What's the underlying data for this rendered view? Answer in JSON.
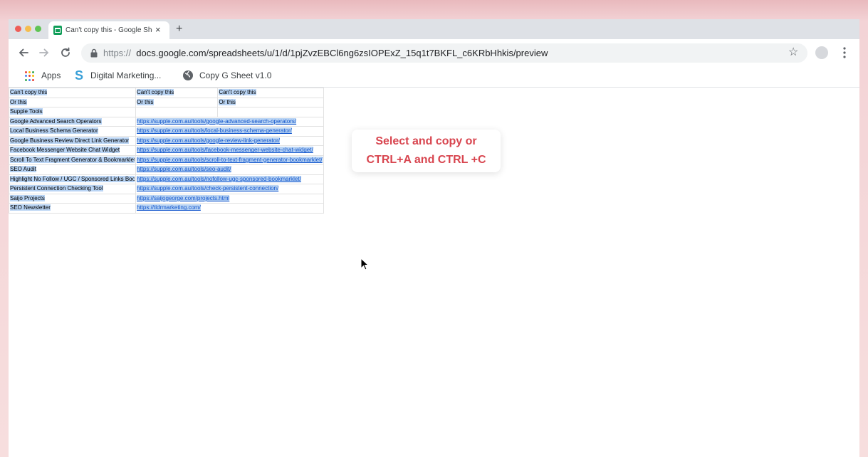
{
  "window": {
    "traffic_lights": [
      "close",
      "minimize",
      "zoom"
    ]
  },
  "tab": {
    "title": "Can't copy this - Google Sheets",
    "favicon": "google-sheets-icon",
    "close_glyph": "×",
    "new_tab_glyph": "+"
  },
  "nav": {
    "back": "back-arrow-icon",
    "forward": "forward-arrow-icon",
    "reload": "reload-icon"
  },
  "omnibox": {
    "scheme": "https://",
    "url": "docs.google.com/spreadsheets/u/1/d/1pjZvzEBCl6ng6zsIOPExZ_15q1t7BKFL_c6KRbHhkis/preview",
    "star_glyph": "☆"
  },
  "bookmarks": [
    {
      "label": "Apps",
      "icon": "apps-grid-icon"
    },
    {
      "label": "Digital Marketing...",
      "icon": "s-logo-icon"
    },
    {
      "label": "Copy G Sheet v1.0",
      "icon": "globe-icon"
    }
  ],
  "sheet": {
    "header_row": [
      "Can't copy this",
      "Can't copy this",
      "Can't copy this"
    ],
    "second_row": [
      "Or this",
      "Or this",
      "Or this"
    ],
    "section": "Supple Tools",
    "rows": [
      {
        "name": "Google Advanced Search Operators",
        "url": "https://supple.com.au/tools/google-advanced-search-operators/"
      },
      {
        "name": "Local Business Schema Generator",
        "url": "https://supple.com.au/tools/local-business-schema-generator/"
      },
      {
        "name": "Google Business Review Direct Link Generator",
        "url": "https://supple.com.au/tools/google-review-link-generator/"
      },
      {
        "name": "Facebook Messenger Website Chat Widget",
        "url": "https://supple.com.au/tools/facebook-messenger-website-chat-widget/"
      },
      {
        "name": "Scroll To Text Fragment Generator & Bookmarklet",
        "url": "https://supple.com.au/tools/scroll-to-text-fragment-generator-bookmarklet/"
      },
      {
        "name": "SEO Audit",
        "url": "https://supple.com.au/tools/seo-audit/"
      },
      {
        "name": "Highlight No Follow / UGC / Sponsored Links Bookmarklet",
        "url": "https://supple.com.au/tools/nofollow-ugc-sponsored-bookmarklet/"
      },
      {
        "name": "Persistent Connection Checking Tool",
        "url": "https://supple.com.au/tools/check-persistent-connection/"
      },
      {
        "name": "Saijo Projects",
        "url": "https://saijogeorge.com/projects.html"
      },
      {
        "name": "SEO Newsletter",
        "url": "https://tldrmarketing.com/"
      }
    ]
  },
  "callout": {
    "line1": "Select and copy or",
    "line2": "CTRL+A and CTRL +C"
  },
  "colors": {
    "selection": "#b9d4f4",
    "link": "#1155cc",
    "callout_text": "#d8454f"
  }
}
